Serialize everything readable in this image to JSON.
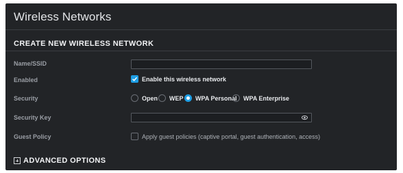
{
  "panel": {
    "title": "Wireless Networks"
  },
  "section": {
    "heading": "CREATE NEW WIRELESS NETWORK"
  },
  "form": {
    "name_label": "Name/SSID",
    "name_value": "",
    "enabled_label": "Enabled",
    "enabled_checkbox_text": "Enable this wireless network",
    "enabled_checked": true,
    "security_label": "Security",
    "security_options": [
      {
        "label": "Open",
        "selected": false
      },
      {
        "label": "WEP",
        "selected": false
      },
      {
        "label": "WPA Personal",
        "selected": true
      },
      {
        "label": "WPA Enterprise",
        "selected": false
      }
    ],
    "security_key_label": "Security Key",
    "security_key_value": "",
    "guest_policy_label": "Guest Policy",
    "guest_policy_text": "Apply guest policies (captive portal, guest authentication, access)",
    "guest_policy_checked": false
  },
  "advanced": {
    "label": "ADVANCED OPTIONS"
  },
  "colors": {
    "accent": "#1e9ee4",
    "panel_bg": "#222427"
  },
  "icons": {
    "checkbox_checked": "checkmark-icon",
    "show_password": "eye-icon",
    "expand": "plus-box-icon"
  }
}
